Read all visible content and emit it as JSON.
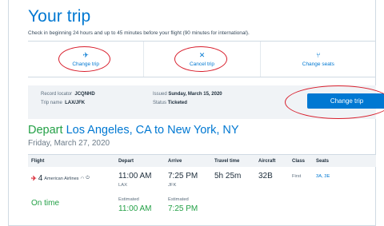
{
  "header": {
    "title": "Your trip",
    "subtitle": "Check in beginning 24 hours and up to 45 minutes before your flight (90 minutes for international)."
  },
  "actions": [
    {
      "label": "Change trip",
      "icon": "plane-icon"
    },
    {
      "label": "Cancel trip",
      "icon": "close-icon"
    },
    {
      "label": "Change seats",
      "icon": "seat-icon"
    }
  ],
  "record": {
    "locator_label": "Record locator",
    "locator_value": "JCQNHD",
    "tripname_label": "Trip name",
    "tripname_value": "LAX/JFK",
    "issued_label": "Issued",
    "issued_value": "Sunday, March 15, 2020",
    "status_label": "Status",
    "status_value": "Ticketed",
    "button": "Change trip"
  },
  "flight_header": {
    "depart_word": "Depart",
    "route": "Los Angeles, CA to New York, NY",
    "date": "Friday, March 27, 2020"
  },
  "table": {
    "columns": [
      "Flight",
      "Depart",
      "Arrive",
      "Travel time",
      "Aircraft",
      "Class",
      "Seats"
    ],
    "row": {
      "flight_number": "4",
      "airline": "American Airlines",
      "depart_time": "11:00 AM",
      "depart_airport": "LAX",
      "arrive_time": "7:25 PM",
      "arrive_airport": "JFK",
      "travel_time": "5h 25m",
      "aircraft": "32B",
      "class": "First",
      "seats": "3A, 3E",
      "status": "On time",
      "estimated_label": "Estimated",
      "est_depart": "11:00 AM",
      "est_arrive": "7:25 PM"
    }
  },
  "colors": {
    "brand_blue": "#0078d2",
    "ontime_green": "#23a046",
    "highlight_red": "#d81e2c"
  }
}
